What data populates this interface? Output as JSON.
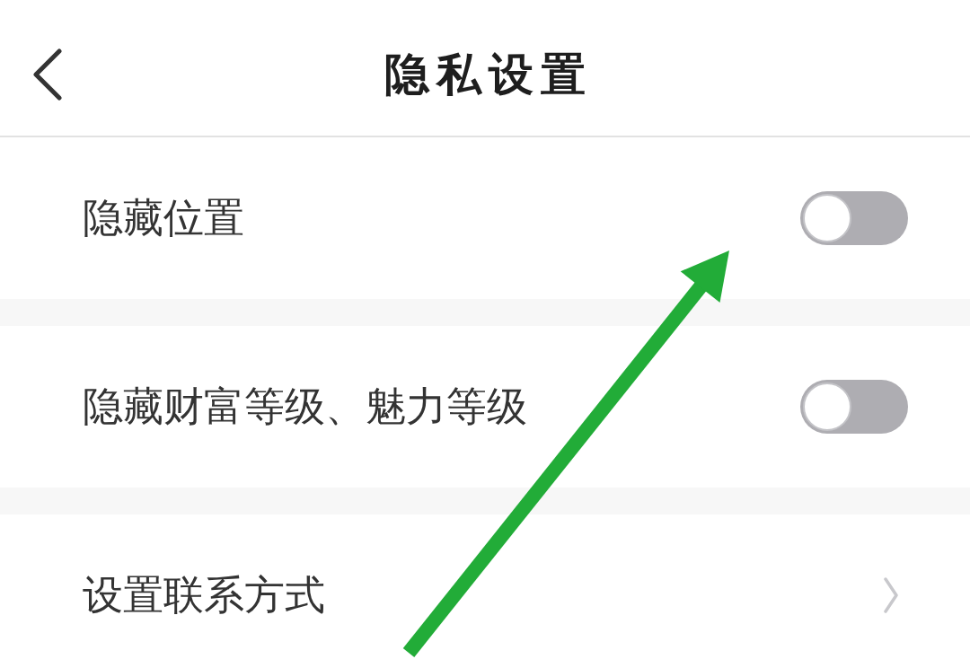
{
  "header": {
    "title": "隐私设置"
  },
  "settings": [
    {
      "kind": "toggle",
      "label": "隐藏位置",
      "on": false
    },
    {
      "kind": "toggle",
      "label": "隐藏财富等级、魅力等级",
      "on": false
    },
    {
      "kind": "link",
      "label": "设置联系方式"
    }
  ]
}
